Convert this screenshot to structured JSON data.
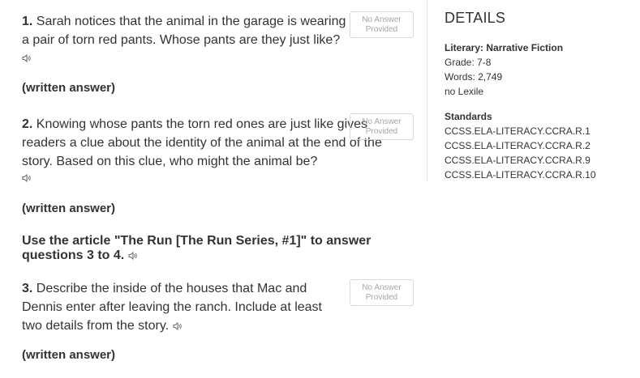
{
  "questions": [
    {
      "number": "1.",
      "text": "Sarah notices that the animal in the garage is wearing a pair of torn red pants. Whose pants are they just like?",
      "status_line1": "No Answer",
      "status_line2": "Provided",
      "answer_label": "(written answer)"
    },
    {
      "number": "2.",
      "text": "Knowing whose pants the torn red ones are just like gives readers a clue about the identity of the animal at the end of the story. Based on this clue, who might the animal be?",
      "status_line1": "No Answer",
      "status_line2": "Provided",
      "answer_label": "(written answer)"
    },
    {
      "number": "3.",
      "text": "Describe the inside of the houses that Mac and Dennis enter after leaving the ranch. Include at least two details from the story.",
      "status_line1": "No Answer",
      "status_line2": "Provided",
      "answer_label": "(written answer)"
    }
  ],
  "instruction": "Use the article \"The Run [The Run Series, #1]\" to answer questions 3 to 4.",
  "details": {
    "heading": "DETAILS",
    "genre": "Literary: Narrative Fiction",
    "grade": "Grade: 7-8",
    "words": "Words: 2,749",
    "lexile": "no Lexile",
    "standards_heading": "Standards",
    "standards": [
      "CCSS.ELA-LITERACY.CCRA.R.1",
      "CCSS.ELA-LITERACY.CCRA.R.2",
      "CCSS.ELA-LITERACY.CCRA.R.9",
      "CCSS.ELA-LITERACY.CCRA.R.10"
    ]
  },
  "icons": {
    "audio": "speaker-icon"
  },
  "colors": {
    "text": "#333333",
    "muted": "#a6a6a6",
    "border": "#d9d9d9"
  }
}
